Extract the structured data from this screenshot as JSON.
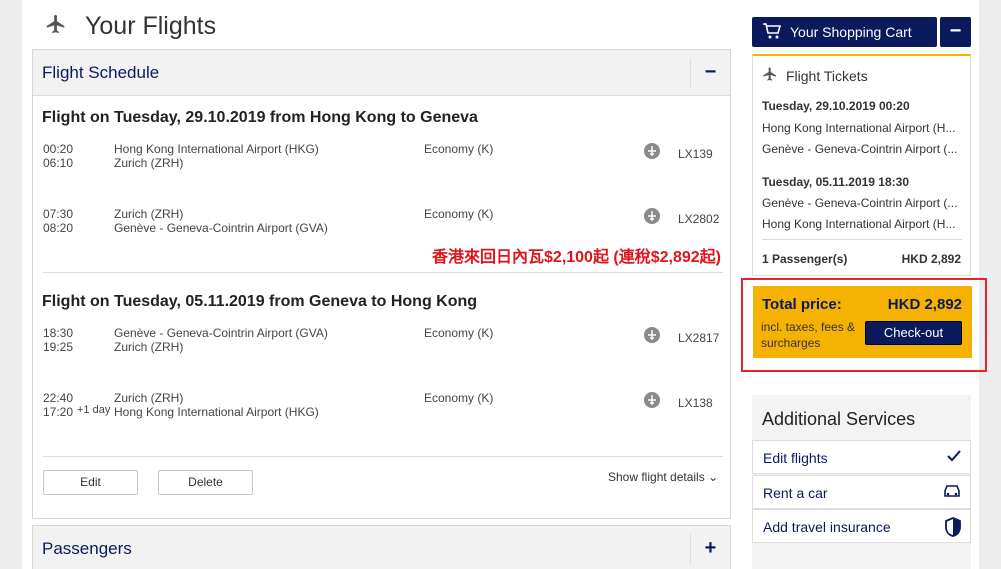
{
  "header": {
    "title": "Your Flights"
  },
  "schedule": {
    "title": "Flight Schedule",
    "toggle": "−",
    "flights": [
      {
        "heading": "Flight on Tuesday, 29.10.2019 from Hong Kong to Geneva",
        "segments": [
          {
            "dep": "00:20",
            "arr": "06:10",
            "from": "Hong Kong International Airport (HKG)",
            "to": "Zurich (ZRH)",
            "class": "Economy (K)",
            "flight": "LX139"
          },
          {
            "dep": "07:30",
            "arr": "08:20",
            "from": "Zurich (ZRH)",
            "to": "Genève - Geneva-Cointrin Airport (GVA)",
            "class": "Economy (K)",
            "flight": "LX2802"
          }
        ]
      },
      {
        "heading": "Flight on Tuesday, 05.11.2019 from Geneva to Hong Kong",
        "segments": [
          {
            "dep": "18:30",
            "arr": "19:25",
            "from": "Genève - Geneva-Cointrin Airport (GVA)",
            "to": "Zurich (ZRH)",
            "class": "Economy (K)",
            "flight": "LX2817"
          },
          {
            "dep": "22:40",
            "arr": "17:20",
            "arr_note": "+1 day",
            "from": "Zurich (ZRH)",
            "to": "Hong Kong International Airport (HKG)",
            "class": "Economy (K)",
            "flight": "LX138"
          }
        ]
      }
    ],
    "promo": "香港來回日內瓦$2,100起 (連稅$2,892起)",
    "edit": "Edit",
    "delete": "Delete",
    "show_details": "Show flight details"
  },
  "passengers": {
    "title": "Passengers",
    "toggle": "+"
  },
  "cart": {
    "button": "Your Shopping Cart",
    "collapse": "−",
    "tickets_title": "Flight Tickets",
    "out_date": "Tuesday, 29.10.2019 00:20",
    "out_from": "Hong Kong International Airport (H...",
    "out_to": "Genève - Geneva-Cointrin Airport (...",
    "ret_date": "Tuesday, 05.11.2019 18:30",
    "ret_from": "Genève - Geneva-Cointrin Airport (...",
    "ret_to": "Hong Kong International Airport (H...",
    "passengers": "1 Passenger(s)",
    "passengers_price": "HKD 2,892"
  },
  "total": {
    "label": "Total price:",
    "value": "HKD 2,892",
    "incl": "incl. taxes, fees & surcharges",
    "checkout": "Check-out"
  },
  "additional": {
    "title": "Additional Services",
    "items": [
      {
        "label": "Edit flights",
        "icon": "check-icon"
      },
      {
        "label": "Rent a car",
        "icon": "car-icon"
      },
      {
        "label": "Add travel insurance",
        "icon": "shield-icon"
      }
    ]
  },
  "colors": {
    "brand": "#0a1a5c",
    "accent": "#f6b200",
    "promo": "#e0151b"
  }
}
